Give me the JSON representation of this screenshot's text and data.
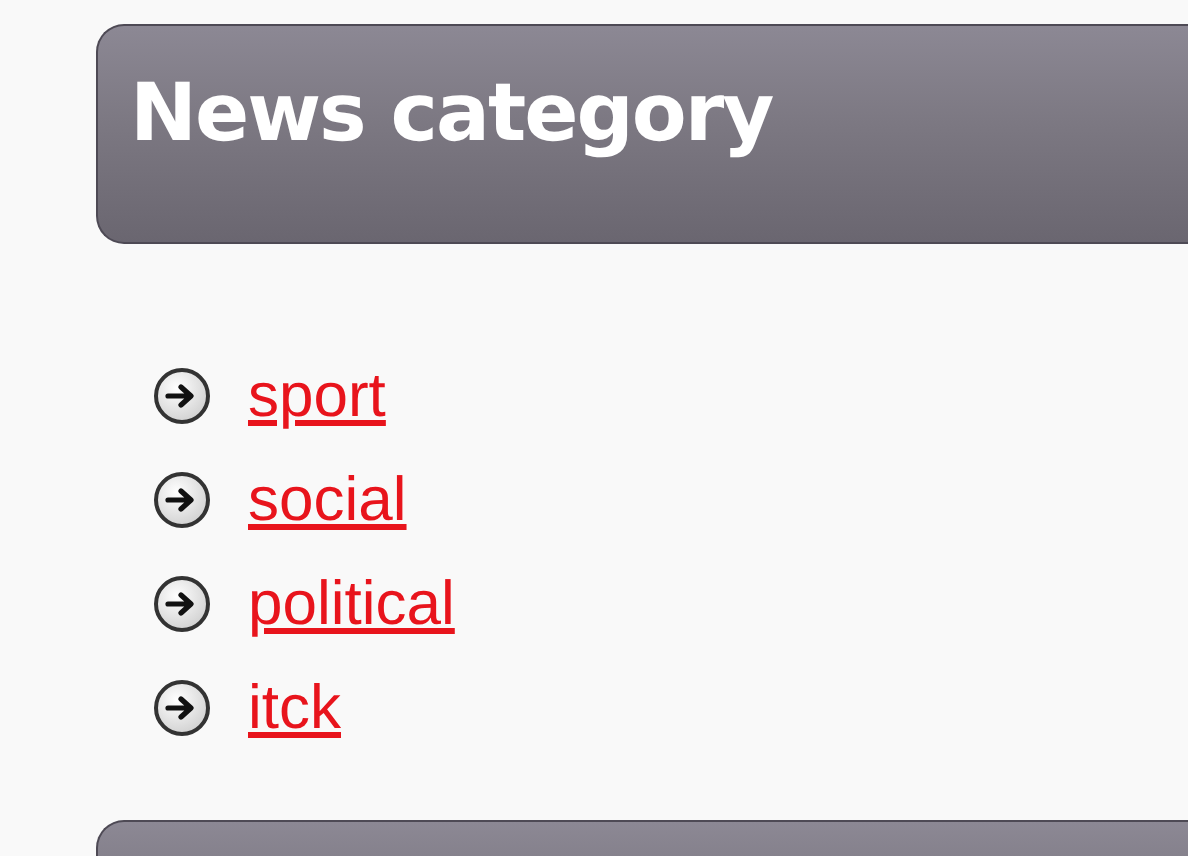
{
  "panel": {
    "title": "News category"
  },
  "categories": [
    {
      "label": "sport"
    },
    {
      "label": "social"
    },
    {
      "label": "political"
    },
    {
      "label": "itck"
    }
  ]
}
